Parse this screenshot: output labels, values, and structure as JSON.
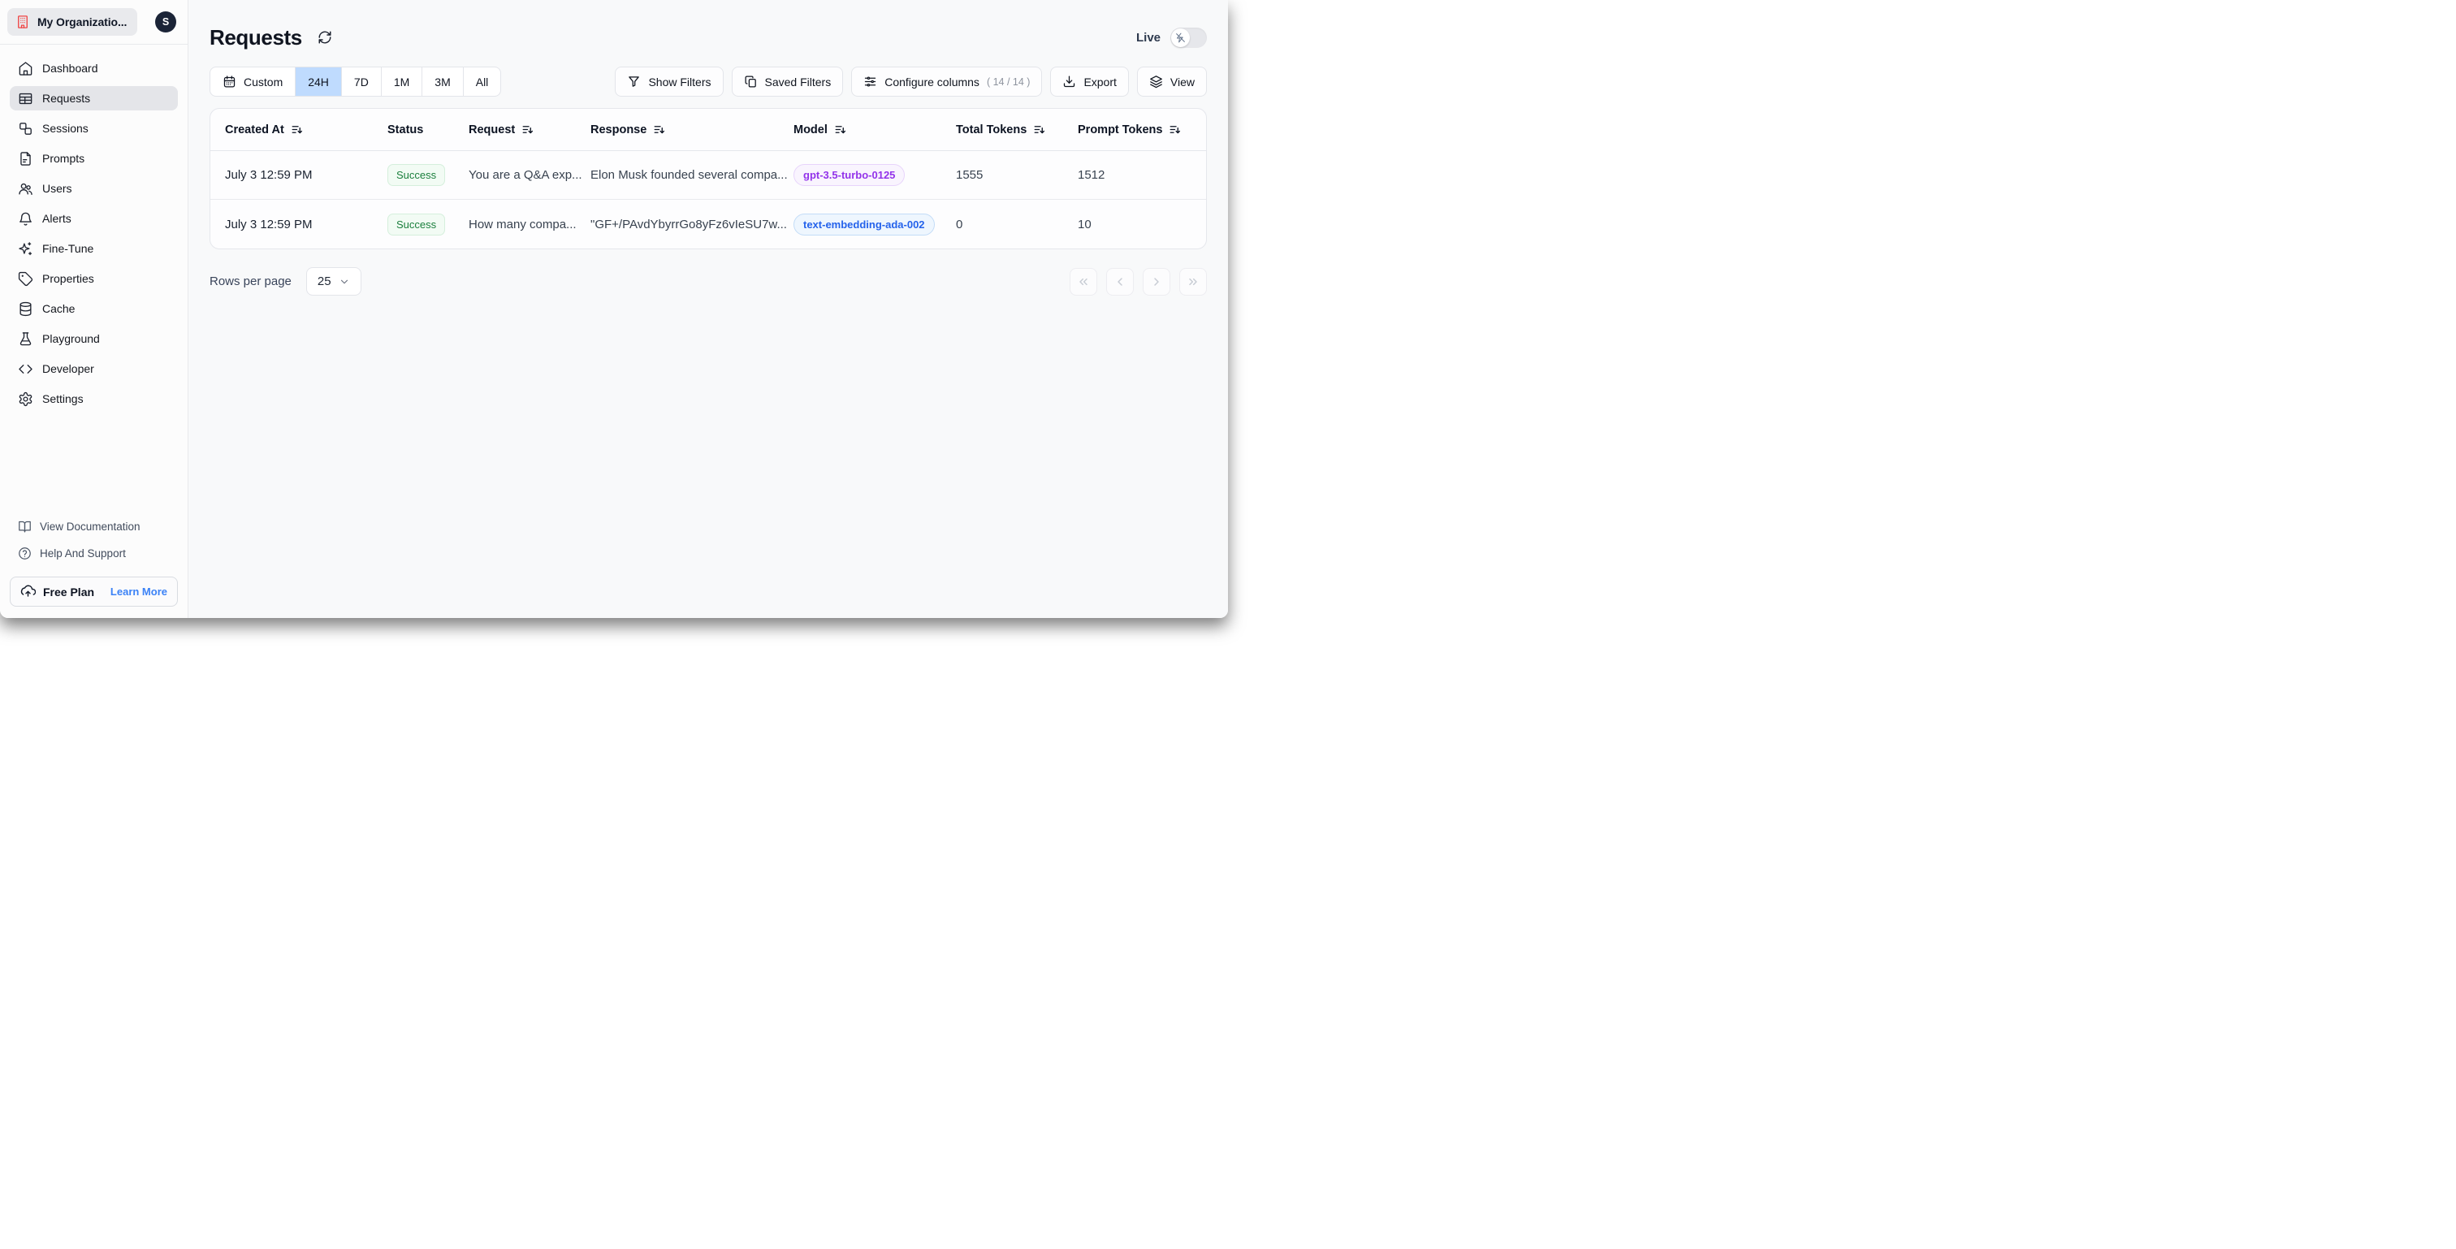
{
  "org": {
    "name": "My Organizatio...",
    "avatar_initial": "S"
  },
  "sidebar": {
    "items": [
      {
        "label": "Dashboard"
      },
      {
        "label": "Requests"
      },
      {
        "label": "Sessions"
      },
      {
        "label": "Prompts"
      },
      {
        "label": "Users"
      },
      {
        "label": "Alerts"
      },
      {
        "label": "Fine-Tune"
      },
      {
        "label": "Properties"
      },
      {
        "label": "Cache"
      },
      {
        "label": "Playground"
      },
      {
        "label": "Developer"
      },
      {
        "label": "Settings"
      }
    ],
    "active_item": "Requests",
    "footer_links": [
      {
        "label": "View Documentation"
      },
      {
        "label": "Help And Support"
      }
    ],
    "plan": {
      "label": "Free Plan",
      "cta": "Learn More"
    }
  },
  "header": {
    "title": "Requests",
    "live_label": "Live"
  },
  "toolbar": {
    "time_ranges": [
      {
        "label": "Custom"
      },
      {
        "label": "24H"
      },
      {
        "label": "7D"
      },
      {
        "label": "1M"
      },
      {
        "label": "3M"
      },
      {
        "label": "All"
      }
    ],
    "selected_range": "24H",
    "show_filters": "Show Filters",
    "saved_filters": "Saved Filters",
    "configure_columns": "Configure columns",
    "configure_columns_count": "( 14 / 14 )",
    "export": "Export",
    "view": "View"
  },
  "table": {
    "columns": [
      {
        "label": "Created At",
        "sortable": true
      },
      {
        "label": "Status",
        "sortable": false
      },
      {
        "label": "Request",
        "sortable": true
      },
      {
        "label": "Response",
        "sortable": true
      },
      {
        "label": "Model",
        "sortable": true
      },
      {
        "label": "Total Tokens",
        "sortable": true
      },
      {
        "label": "Prompt Tokens",
        "sortable": true
      }
    ],
    "rows": [
      {
        "created_at": "July 3 12:59 PM",
        "status": "Success",
        "request": "You are a Q&A exp...",
        "response": "Elon Musk founded several compa...",
        "model": "gpt-3.5-turbo-0125",
        "total_tokens": "1555",
        "prompt_tokens": "1512"
      },
      {
        "created_at": "July 3 12:59 PM",
        "status": "Success",
        "request": "How many compa...",
        "response": "\"GF+/PAvdYbyrrGo8yFz6vIeSU7w...",
        "model": "text-embedding-ada-002",
        "total_tokens": "0",
        "prompt_tokens": "10"
      }
    ]
  },
  "pagination": {
    "rows_per_page_label": "Rows per page",
    "rows_per_page_value": "25"
  },
  "colors": {
    "selected_range_bg": "#bfdbfe",
    "success_green": "#1a7f3c",
    "model_purple": "#9333ea",
    "model_blue": "#2563eb",
    "org_icon_red": "#ef4444",
    "link_blue": "#3b82f6"
  }
}
